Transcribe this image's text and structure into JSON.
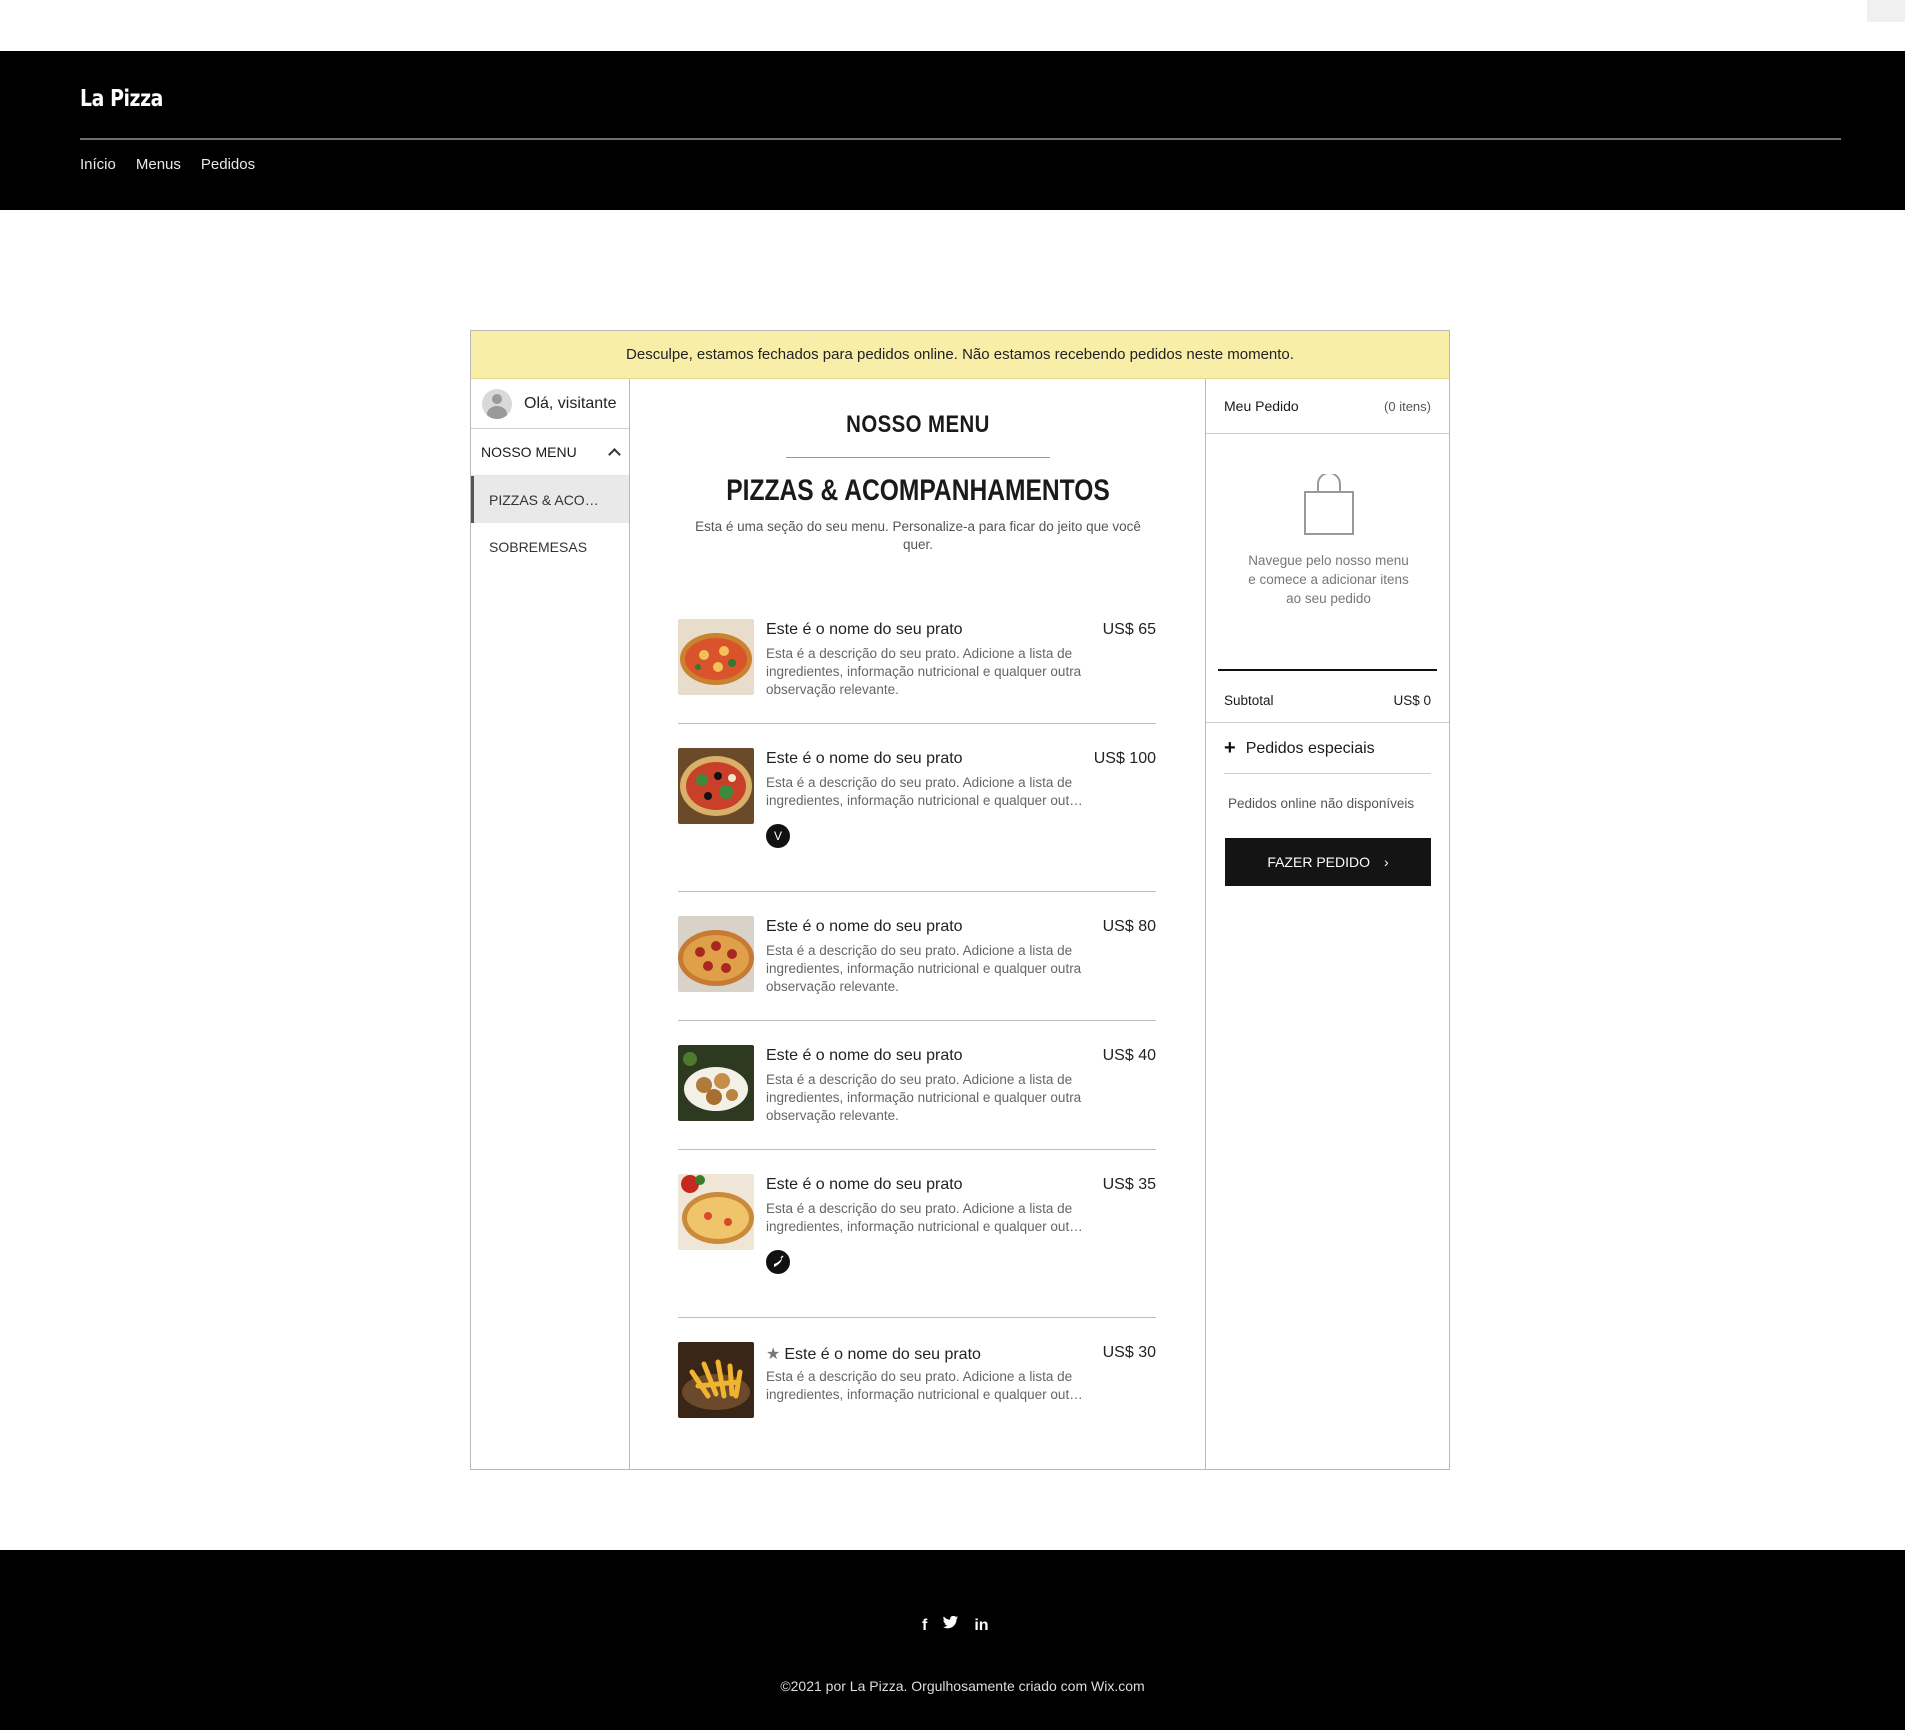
{
  "header": {
    "site_title": "La Pizza",
    "nav": [
      "Início",
      "Menus",
      "Pedidos"
    ]
  },
  "notice": "Desculpe, estamos fechados para pedidos online. Não estamos recebendo pedidos neste momento.",
  "sidebar": {
    "greeting": "Olá, visitante",
    "menu_label": "NOSSO MENU",
    "categories": [
      "PIZZAS & ACOMPANHAMENTOS",
      "SOBREMESAS"
    ]
  },
  "menu": {
    "title": "NOSSO MENU",
    "section_title": "PIZZAS & ACOMPANHAMENTOS",
    "section_desc": "Esta é uma seção do seu menu. Personalize-a para ficar do jeito que você quer.",
    "dishes": [
      {
        "name": "Este é o nome do seu prato",
        "price": "US$ 65",
        "desc": "Esta é a descrição do seu prato. Adicione a lista de ingredientes, informação nutricional e qualquer outra observação relevante.",
        "badge": ""
      },
      {
        "name": "Este é o nome do seu prato",
        "price": "US$ 100",
        "desc": "Esta é a descrição do seu prato. Adicione a lista de ingredientes, informação nutricional e qualquer outra observação relevante.",
        "badge": "V"
      },
      {
        "name": "Este é o nome do seu prato",
        "price": "US$ 80",
        "desc": "Esta é a descrição do seu prato. Adicione a lista de ingredientes, informação nutricional e qualquer outra observação relevante.",
        "badge": ""
      },
      {
        "name": "Este é o nome do seu prato",
        "price": "US$ 40",
        "desc": "Esta é a descrição do seu prato. Adicione a lista de ingredientes, informação nutricional e qualquer outra observação relevante.",
        "badge": ""
      },
      {
        "name": "Este é o nome do seu prato",
        "price": "US$ 35",
        "desc": "Esta é a descrição do seu prato. Adicione a lista de ingredientes, informação nutricional e qualquer outra observação relevante.",
        "badge": "spicy-icon"
      },
      {
        "name": "Este é o nome do seu prato",
        "price": "US$ 30",
        "desc": "Esta é a descrição do seu prato. Adicione a lista de ingredientes, informação nutricional e qualquer outra observação relevante.",
        "badge": "",
        "featured": true
      }
    ]
  },
  "cart": {
    "title": "Meu Pedido",
    "count": "(0 itens)",
    "empty_text": "Navegue pelo nosso menu e comece a adicionar itens ao seu pedido",
    "subtotal_label": "Subtotal",
    "subtotal_value": "US$ 0",
    "special_label": "Pedidos especiais",
    "unavailable": "Pedidos online não disponíveis",
    "order_button": "FAZER PEDIDO"
  },
  "footer": {
    "social": [
      "facebook-icon",
      "twitter-icon",
      "linkedin-icon"
    ],
    "copyright": "©2021 por La Pizza. Orgulhosamente criado com Wix.com"
  },
  "colors": {
    "header_bg": "#000000",
    "notice_bg": "#f9eea8",
    "button_bg": "#141414"
  }
}
